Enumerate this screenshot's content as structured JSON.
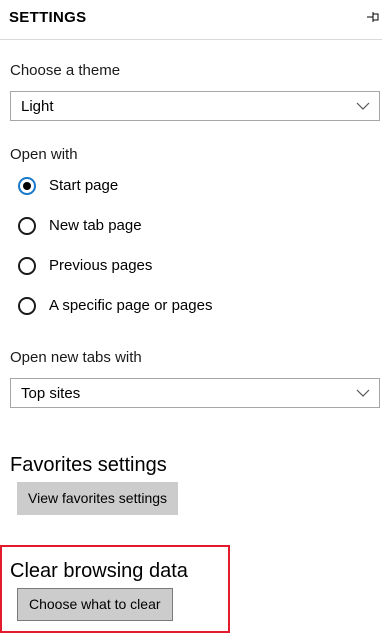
{
  "header": {
    "title": "SETTINGS",
    "pin_icon": "pin-icon"
  },
  "theme": {
    "label": "Choose a theme",
    "selected": "Light",
    "chevron_icon": "chevron-down-icon"
  },
  "open_with": {
    "label": "Open with",
    "options": [
      {
        "label": "Start page",
        "checked": true
      },
      {
        "label": "New tab page",
        "checked": false
      },
      {
        "label": "Previous pages",
        "checked": false
      },
      {
        "label": "A specific page or pages",
        "checked": false
      }
    ]
  },
  "new_tabs": {
    "label": "Open new tabs with",
    "selected": "Top sites",
    "chevron_icon": "chevron-down-icon"
  },
  "favorites": {
    "title": "Favorites settings",
    "button_label": "View favorites settings"
  },
  "clear_data": {
    "title": "Clear browsing data",
    "button_label": "Choose what to clear",
    "highlight_color": "#e21a2b"
  },
  "colors": {
    "accent": "#1979ca",
    "button_bg": "#cccccc"
  }
}
